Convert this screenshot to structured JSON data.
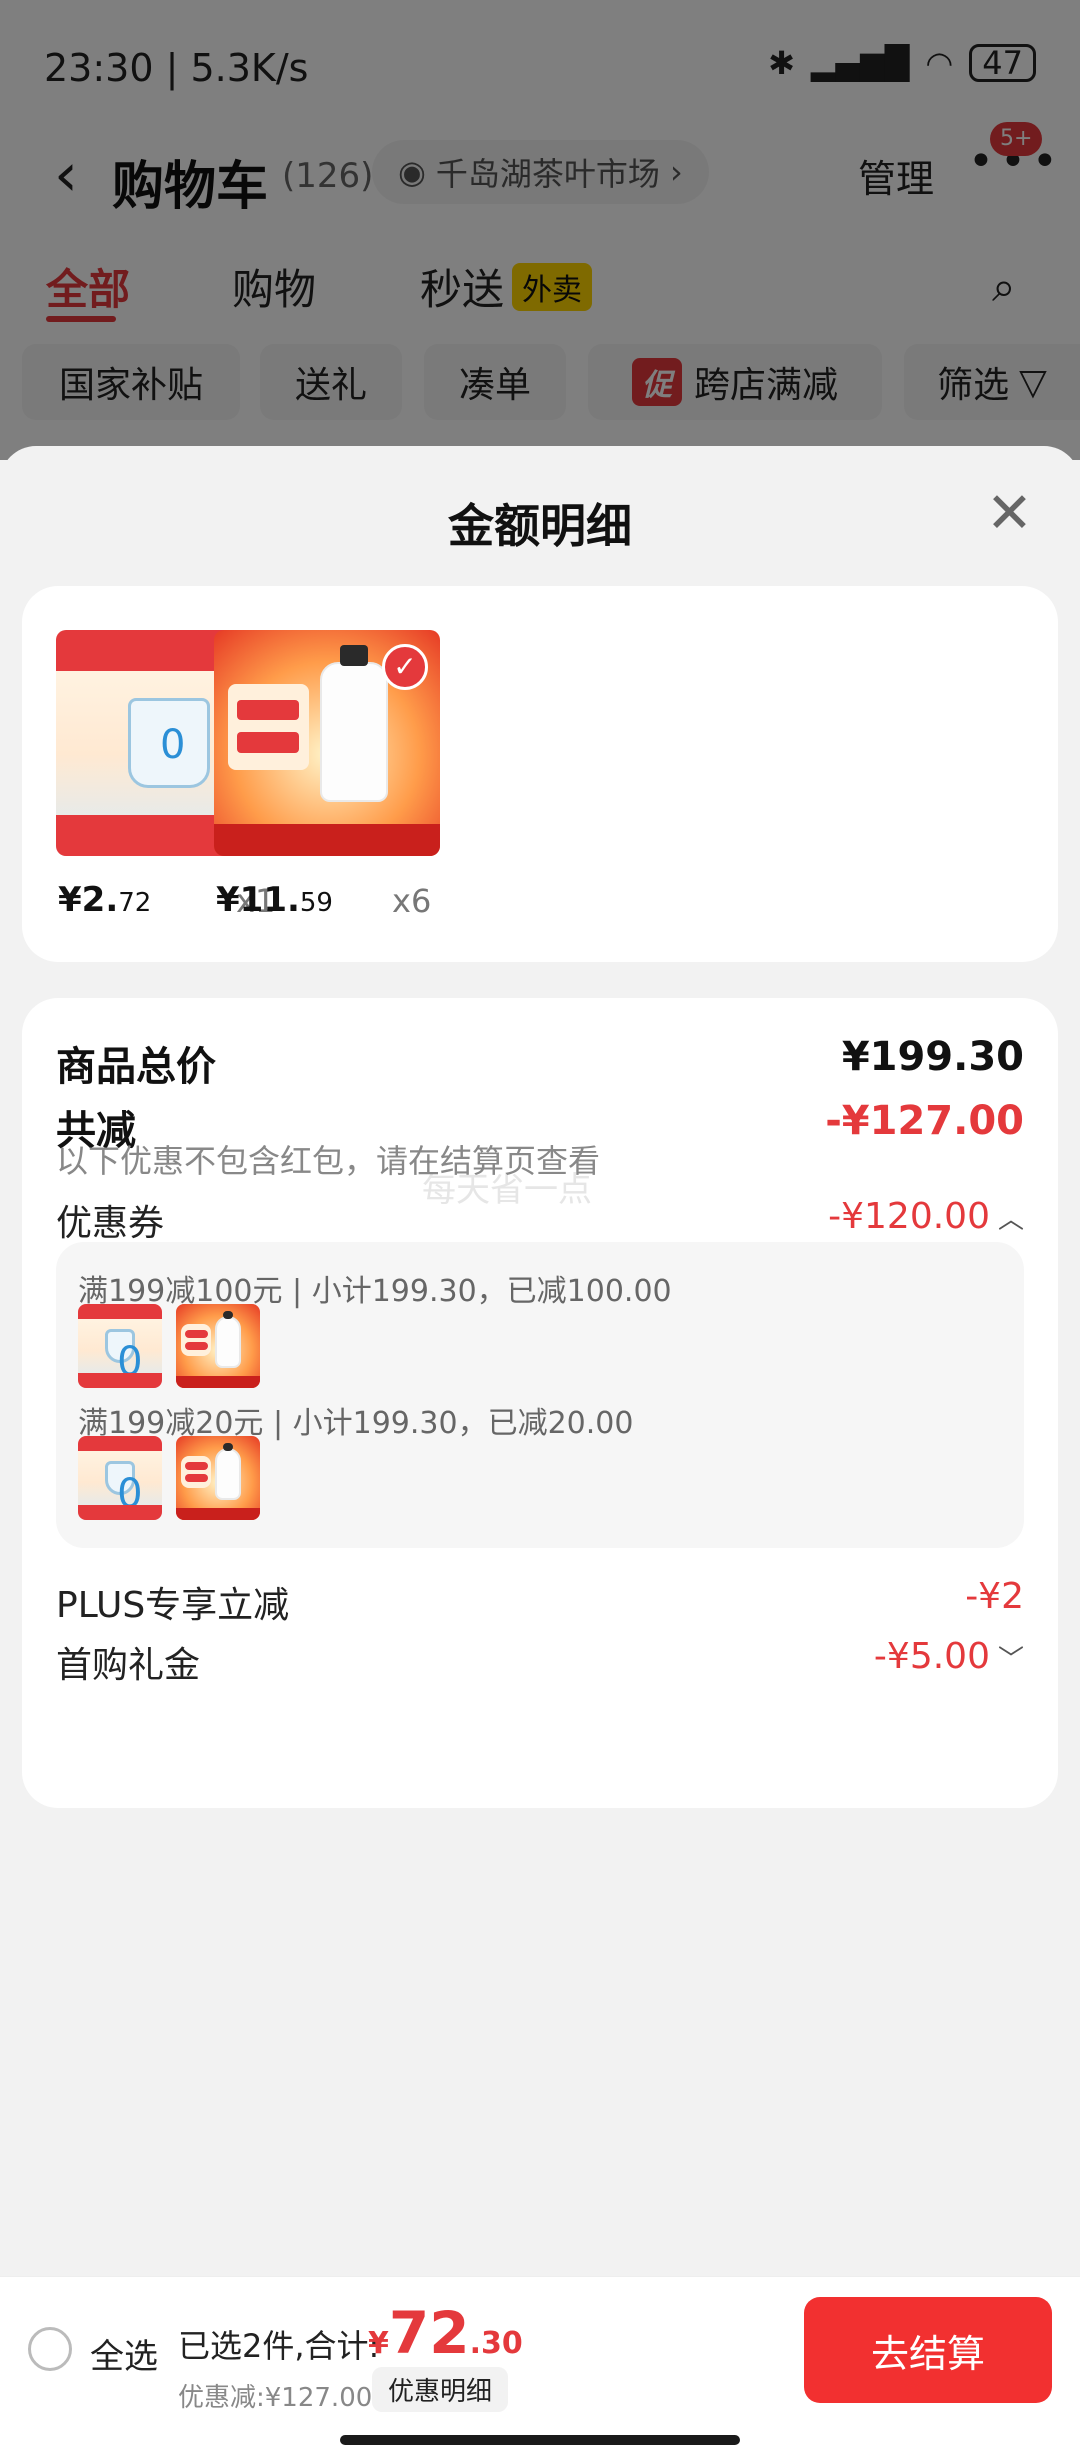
{
  "status_bar": {
    "time": "23:30 | 5.3K/s",
    "battery": "47",
    "icons": [
      "bluetooth-icon",
      "hd-signal-icon",
      "wifi-icon",
      "battery-icon"
    ]
  },
  "header": {
    "title": "购物车",
    "count": "(126)",
    "location": "千岛湖茶叶市场",
    "manage": "管理",
    "badge": "5+"
  },
  "tabs": [
    {
      "label": "全部",
      "active": true
    },
    {
      "label": "购物",
      "active": false
    },
    {
      "label": "秒送",
      "tag": "外卖",
      "active": false
    }
  ],
  "filters": [
    "国家补贴",
    "送礼",
    "凑单",
    "跨店满减",
    "筛选"
  ],
  "filter_promo_mark": "促",
  "sheet": {
    "title": "金额明细",
    "products": [
      {
        "price_int": "¥2.",
        "price_dec": "72",
        "qty": "x1",
        "thumb": "yogurt"
      },
      {
        "price_int": "¥11.",
        "price_dec": "59",
        "qty": "x6",
        "thumb": "milk"
      }
    ],
    "summary": {
      "total_label": "商品总价",
      "total_value": "¥199.30",
      "reduce_label": "共减",
      "reduce_value": "-¥127.00",
      "watermark": "每天省一点",
      "reduce_note": "以下优惠不包含红包，请在结算页查看",
      "coupon_label": "优惠券",
      "coupon_value": "-¥120.00",
      "coupons": [
        {
          "text": "满199减100元 | 小计199.30，已减100.00"
        },
        {
          "text": "满199减20元 | 小计199.30，已减20.00"
        }
      ],
      "plus_label": "PLUS专享立减",
      "plus_value": "-¥2",
      "gift_label": "首购礼金",
      "gift_value": "-¥5.00"
    }
  },
  "checkout": {
    "select_all": "全选",
    "selected_text": "已选2件,合计:",
    "total_yen": "¥",
    "total_big": "72",
    "total_dec": ".30",
    "saved_text": "优惠减:¥127.00",
    "detail_chip": "优惠明细",
    "button": "去结算"
  },
  "colors": {
    "accent": "#e4393c",
    "checkout_button": "#f23030",
    "tab_tag": "#ffd400"
  }
}
